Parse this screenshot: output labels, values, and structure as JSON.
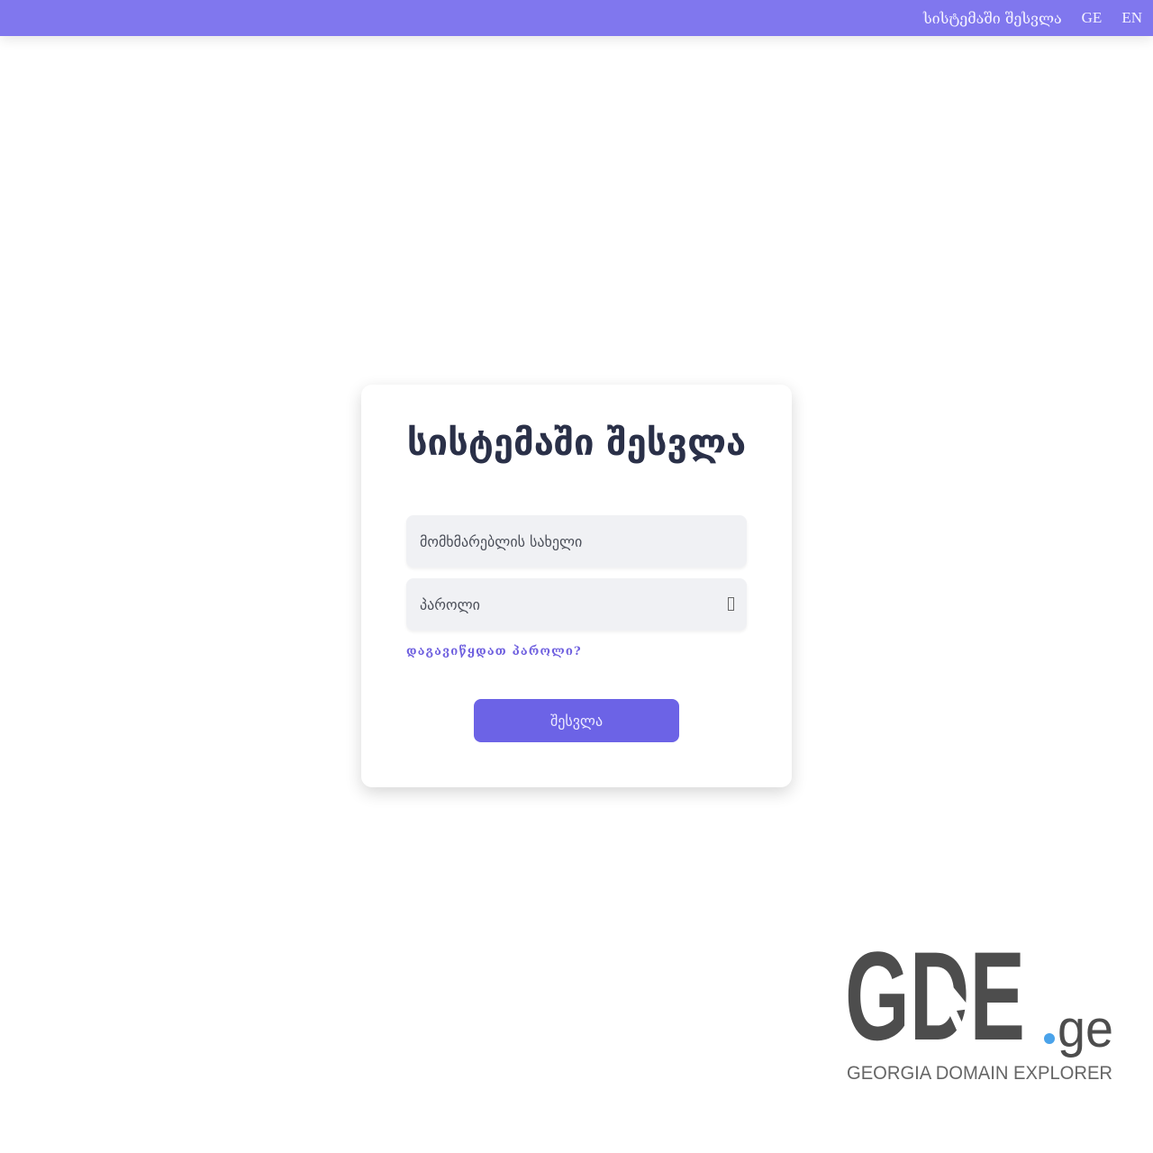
{
  "nav": {
    "login_link": "სისტემაში შესვლა",
    "lang_ge": "GE",
    "lang_en": "EN"
  },
  "login_form": {
    "title": "სისტემაში შესვლა",
    "username_placeholder": "მომხმარებლის სახელი",
    "password_placeholder": "პაროლი",
    "forgot_password": "დაგავიწყდათ პაროლი?",
    "submit_label": "შესვლა"
  },
  "logo": {
    "main_text": "GDE",
    "domain_text": "ge",
    "tagline": "GEORGIA DOMAIN EXPLORER",
    "main_color": "#4d4d4d",
    "dot_color": "#4aa3ea"
  },
  "colors": {
    "topbar": "#8077ee",
    "accent": "#6c63e6",
    "title": "#2a3048"
  }
}
